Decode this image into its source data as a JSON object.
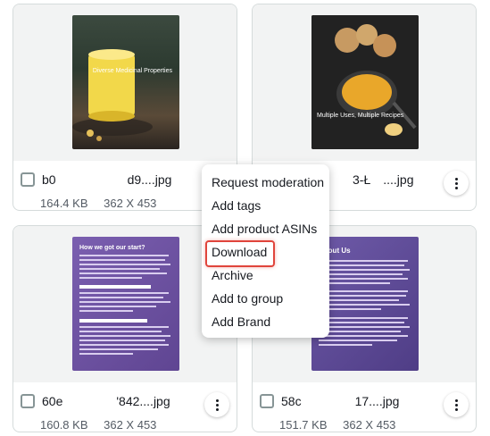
{
  "cards": [
    {
      "name_left": "b0",
      "name_right": "d9....jpg",
      "size": "164.4 KB",
      "dims": "362 X 453",
      "caption": "Diverse Medicinal Properties"
    },
    {
      "name_left": "3-Ł",
      "name_right": "....jpg",
      "size": "",
      "dims": "",
      "caption": "Multiple Uses, Multiple Recipes"
    },
    {
      "name_left": "60e",
      "name_right": "'842....jpg",
      "size": "160.8 KB",
      "dims": "362 X 453",
      "caption_title": "How we got our start?"
    },
    {
      "name_left": "58c",
      "name_right": "17....jpg",
      "size": "151.7 KB",
      "dims": "362 X 453",
      "caption_title": "About Us"
    }
  ],
  "menu": {
    "items": [
      "Request moderation",
      "Add tags",
      "Add product ASINs",
      "Download",
      "Archive",
      "Add to group",
      "Add Brand"
    ]
  },
  "colors": {
    "highlight": "#e0453c",
    "purple": "#6b4f9e"
  }
}
